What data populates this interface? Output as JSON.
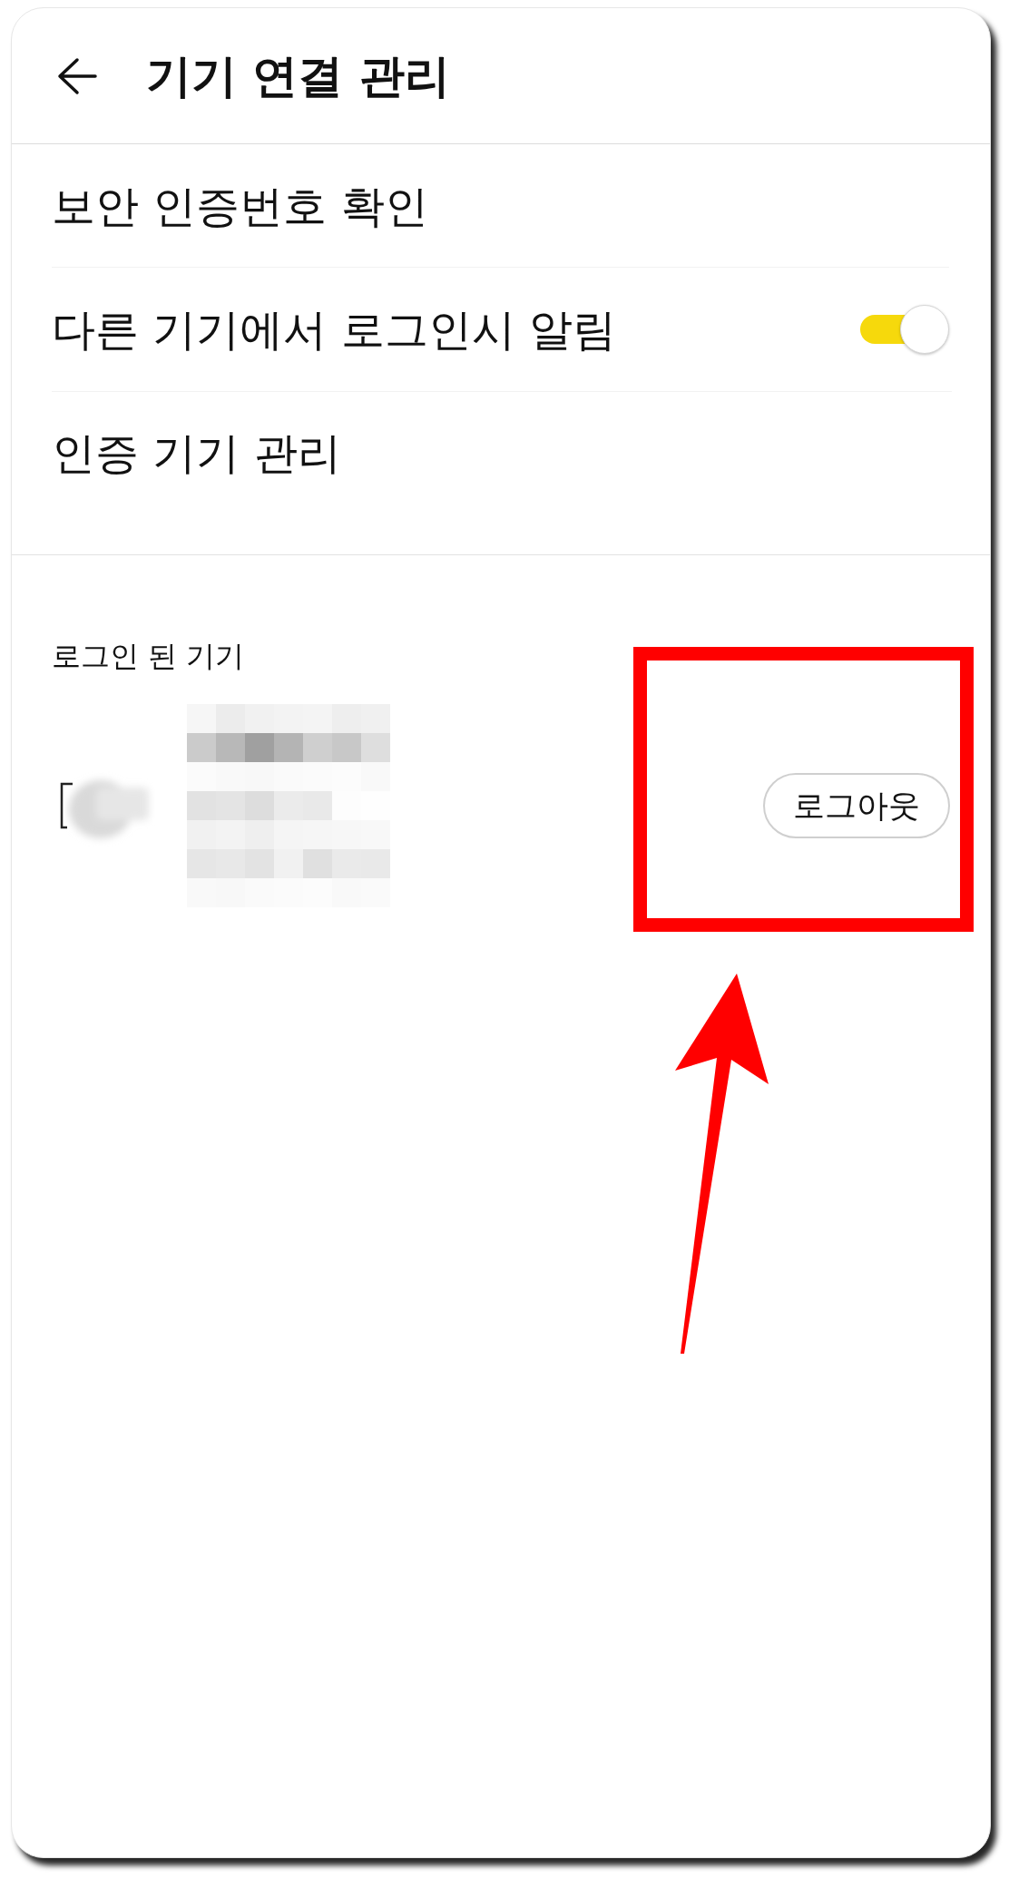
{
  "header": {
    "title": "기기 연결 관리"
  },
  "settings": [
    {
      "kind": "link",
      "label": "보안 인증번호 확인"
    },
    {
      "kind": "toggle",
      "label": "다른 기기에서 로그인시 알림",
      "on": true
    },
    {
      "kind": "link",
      "label": "인증 기기 관리"
    }
  ],
  "logged_in_devices": {
    "label": "로그인 된 기기",
    "devices": [
      {
        "action": "로그아웃"
      }
    ]
  }
}
